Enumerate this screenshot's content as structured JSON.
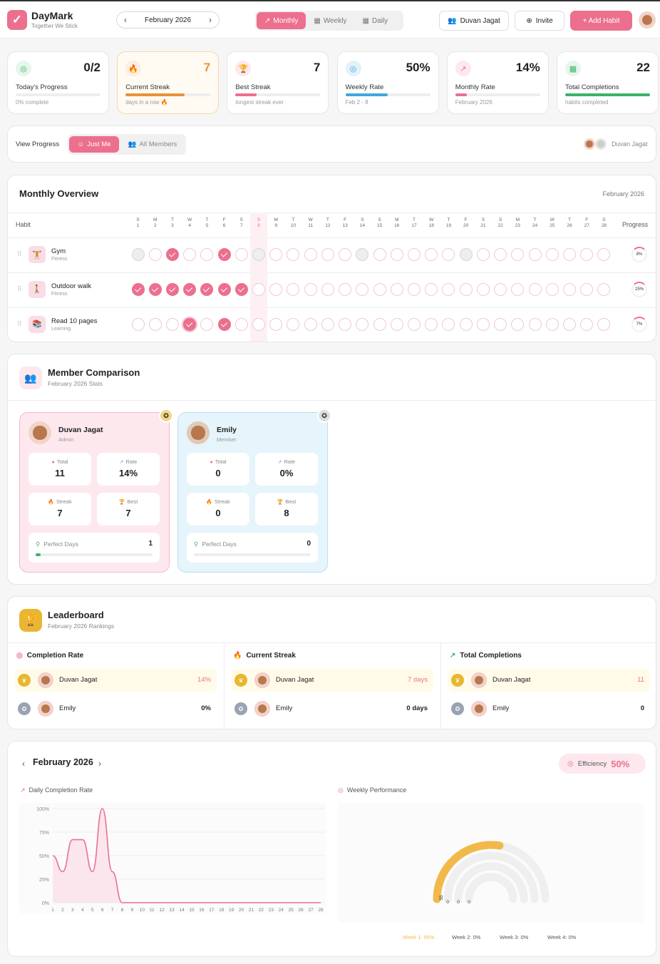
{
  "header": {
    "brand": "DayMark",
    "tagline": "Together We Stick",
    "month": "February 2026",
    "views": [
      "Monthly",
      "Weekly",
      "Daily"
    ],
    "user_button": "Duvan Jagat",
    "invite": "Invite",
    "add_habit": "+ Add Habit"
  },
  "stats": [
    {
      "value": "0/2",
      "label": "Today's Progress",
      "sub": "0% complete",
      "color": "#3ab36a",
      "fill": 0
    },
    {
      "value": "7",
      "label": "Current Streak",
      "sub": "days in a row 🔥",
      "color": "#e8913a",
      "fill": 0.7
    },
    {
      "value": "7",
      "label": "Best Streak",
      "sub": "longest streak ever",
      "color": "#ec6f8e",
      "fill": 0.25
    },
    {
      "value": "50%",
      "label": "Weekly Rate",
      "sub": "Feb 2 - 8",
      "color": "#3ea8d8",
      "fill": 0.5
    },
    {
      "value": "14%",
      "label": "Monthly Rate",
      "sub": "February 2026",
      "color": "#ec6f8e",
      "fill": 0.14
    },
    {
      "value": "22",
      "label": "Total Completions",
      "sub": "habits completed",
      "color": "#3ab36a",
      "fill": 1
    }
  ],
  "view_progress": {
    "label": "View Progress",
    "just_me": "Just Me",
    "all_members": "All Members",
    "member_name": "Duvan Jagat"
  },
  "overview": {
    "title": "Monthly Overview",
    "month": "February 2026",
    "col_habit": "Habit",
    "col_progress": "Progress",
    "day_letters": [
      "S",
      "M",
      "T",
      "W",
      "T",
      "F",
      "S",
      "S",
      "M",
      "T",
      "W",
      "T",
      "F",
      "S",
      "S",
      "M",
      "T",
      "W",
      "T",
      "F",
      "S",
      "S",
      "M",
      "T",
      "W",
      "T",
      "F",
      "S"
    ],
    "today_index": 7,
    "habits": [
      {
        "name": "Gym",
        "category": "Fitness",
        "progress": "8%",
        "days": "mxdxxdxmxxxxxmxxxxxmxxxxxxxx"
      },
      {
        "name": "Outdoor walk",
        "category": "Fitness",
        "progress": "25%",
        "days": "dddddddxxxxxxxxxxxxxxxxxxxxx"
      },
      {
        "name": "Read 10 pages",
        "category": "Learning",
        "progress": "7%",
        "days": "xxxdxdxxxxxxxxxxxxxxxxxxxxxx"
      }
    ]
  },
  "member_comparison": {
    "title": "Member Comparison",
    "subtitle": "February 2026 Stats",
    "labels": {
      "total": "Total",
      "rate": "Rate",
      "streak": "Streak",
      "best": "Best",
      "perfect": "Perfect Days"
    },
    "members": [
      {
        "name": "Duvan Jagat",
        "role": "Admin",
        "total": "11",
        "rate": "14%",
        "streak": "7",
        "best": "7",
        "perfect": "1",
        "perfect_fill": 0.04
      },
      {
        "name": "Emily",
        "role": "Member",
        "total": "0",
        "rate": "0%",
        "streak": "0",
        "best": "8",
        "perfect": "0",
        "perfect_fill": 0
      }
    ]
  },
  "leaderboard": {
    "title": "Leaderboard",
    "subtitle": "February 2026 Rankings",
    "columns": [
      {
        "title": "Completion Rate",
        "rows": [
          {
            "name": "Duvan Jagat",
            "value": "14%"
          },
          {
            "name": "Emily",
            "value": "0%"
          }
        ]
      },
      {
        "title": "Current Streak",
        "rows": [
          {
            "name": "Duvan Jagat",
            "value": "7 days"
          },
          {
            "name": "Emily",
            "value": "0 days"
          }
        ]
      },
      {
        "title": "Total Completions",
        "rows": [
          {
            "name": "Duvan Jagat",
            "value": "11"
          },
          {
            "name": "Emily",
            "value": "0"
          }
        ]
      }
    ]
  },
  "analytics": {
    "month": "February 2026",
    "efficiency_label": "Efficiency",
    "efficiency_value": "50%",
    "daily_title": "Daily Completion Rate",
    "weekly_title": "Weekly Performance",
    "week_legend": [
      "Week 1: 55%",
      "Week 2: 0%",
      "Week 3: 0%",
      "Week 4: 0%"
    ],
    "arc_labels": [
      "55",
      "0",
      "0",
      "0"
    ]
  },
  "chart_data": [
    {
      "type": "area",
      "title": "Daily Completion Rate",
      "x": [
        1,
        2,
        3,
        4,
        5,
        6,
        7,
        8,
        9,
        10,
        11,
        12,
        13,
        14,
        15,
        16,
        17,
        18,
        19,
        20,
        21,
        22,
        23,
        24,
        25,
        26,
        27,
        28
      ],
      "values": [
        50,
        33,
        67,
        67,
        33,
        100,
        33,
        0,
        0,
        0,
        0,
        0,
        0,
        0,
        0,
        0,
        0,
        0,
        0,
        0,
        0,
        0,
        0,
        0,
        0,
        0,
        0,
        0
      ],
      "y_ticks": [
        "0%",
        "25%",
        "50%",
        "75%",
        "100%"
      ],
      "ylim": [
        0,
        100
      ],
      "color": "#ec6f8e"
    },
    {
      "type": "bar",
      "title": "Weekly Performance",
      "categories": [
        "Week 1",
        "Week 2",
        "Week 3",
        "Week 4"
      ],
      "values": [
        55,
        0,
        0,
        0
      ],
      "color": "#f2b94a"
    }
  ]
}
